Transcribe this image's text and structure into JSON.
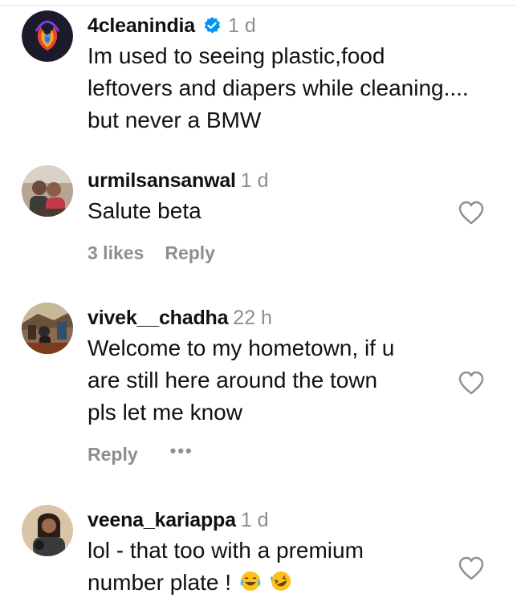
{
  "comments": [
    {
      "username": "4cleanindia",
      "verified": true,
      "time": "1 d",
      "lines": [
        "Im used to seeing plastic,food",
        "leftovers and diapers while cleaning....",
        "but never a BMW"
      ],
      "avatar_icon": "peacock-logo-avatar"
    },
    {
      "username": "urmilsansanwal",
      "time": "1 d",
      "lines": [
        "Salute beta"
      ],
      "likes": "3 likes",
      "reply": "Reply",
      "avatar_icon": "couple-photo-avatar"
    },
    {
      "username": "vivek__chadha",
      "time": "22 h",
      "lines": [
        "Welcome to my hometown, if u",
        "are still here around the town",
        "pls let me know"
      ],
      "reply": "Reply",
      "more": "•••",
      "avatar_icon": "street-photo-avatar"
    },
    {
      "username": "veena_kariappa",
      "time": "1 d",
      "lines": [
        "lol - that too with a premium",
        "number plate !"
      ],
      "emojis": [
        "face-with-tears-of-joy",
        "rolling-on-floor-laughing"
      ],
      "avatar_icon": "woman-photo-avatar"
    }
  ],
  "colors": {
    "username": "#111111",
    "meta": "#8e8e8e",
    "verified": "#0095f6",
    "heart_stroke": "#8e8e8e"
  }
}
